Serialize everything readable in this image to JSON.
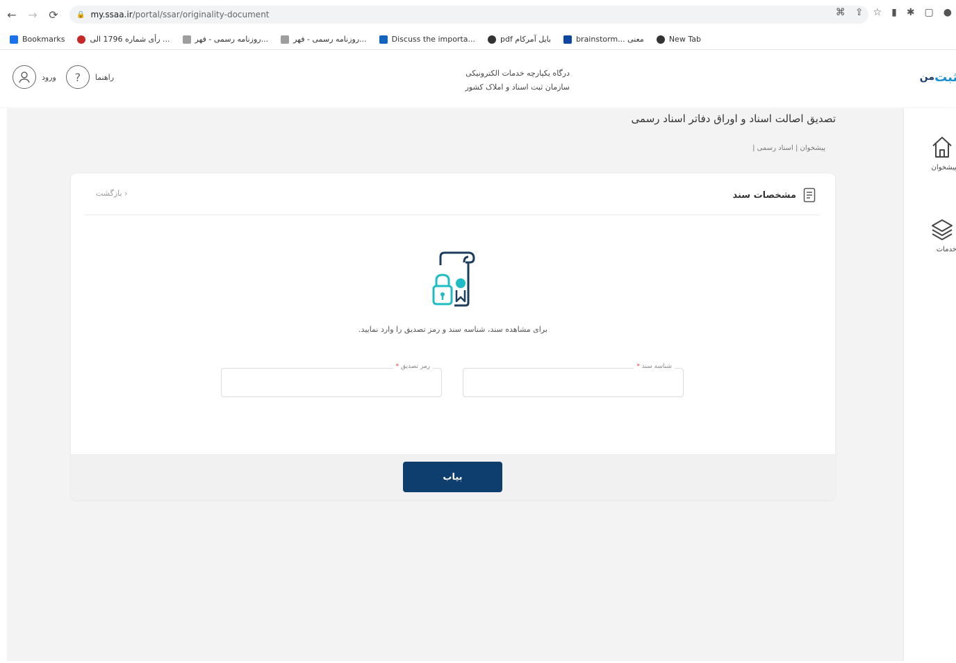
{
  "browser": {
    "url_host": "my.ssaa.ir",
    "url_path": "/portal/ssar/originality-document",
    "bookmarks": [
      {
        "label": "Bookmarks",
        "icon": "star-icon",
        "color": "#1a73e8"
      },
      {
        "label": "رأی شماره 1796 الی ...",
        "icon": "emblem-icon",
        "color": "#c62828"
      },
      {
        "label": "روزنامه رسمی - فهر...",
        "icon": "page-icon",
        "color": "#9e9e9e"
      },
      {
        "label": "روزنامه رسمی - فهر...",
        "icon": "page-icon",
        "color": "#9e9e9e"
      },
      {
        "label": "Discuss the importa...",
        "icon": "forum-icon",
        "color": "#1565c0"
      },
      {
        "label": "pdf بایل آمرکام",
        "icon": "globe-icon",
        "color": "#333333"
      },
      {
        "label": "brainstorm... معنی",
        "icon": "bookmark-icon",
        "color": "#0d47a1"
      },
      {
        "label": "New Tab",
        "icon": "globe-icon",
        "color": "#333333"
      }
    ]
  },
  "header": {
    "logo_text_a": "ثبت",
    "logo_text_b": "من",
    "portal_line1": "درگاه یکپارچه خدمات الکترونیکی",
    "portal_line2": "سازمان ثبت اسناد و املاک کشور",
    "help_label": "راهنما",
    "login_label": "ورود"
  },
  "rail": {
    "dashboard_label": "پیشخوان",
    "services_label": "خدمات"
  },
  "page": {
    "title": "تصدیق اصالت اسناد و اوراق دفاتر اسناد رسمی",
    "breadcrumb": "پیشخوان | اسناد رسمی |"
  },
  "card": {
    "title": "مشخصات سند",
    "back_label": "بازگشت ›",
    "instruction": "برای مشاهده سند، شناسه سند و رمز تصدیق را وارد نمایید.",
    "doc_id_label": "شناسه سند",
    "doc_id_value": "",
    "pin_label": "رمز تصدیق",
    "pin_value": "",
    "required_mark": "*",
    "submit_label": "بیاب"
  },
  "colors": {
    "primary": "#0d3e6d",
    "accent_teal": "#1fbcc3",
    "logo_blue": "#1b8fd2"
  }
}
